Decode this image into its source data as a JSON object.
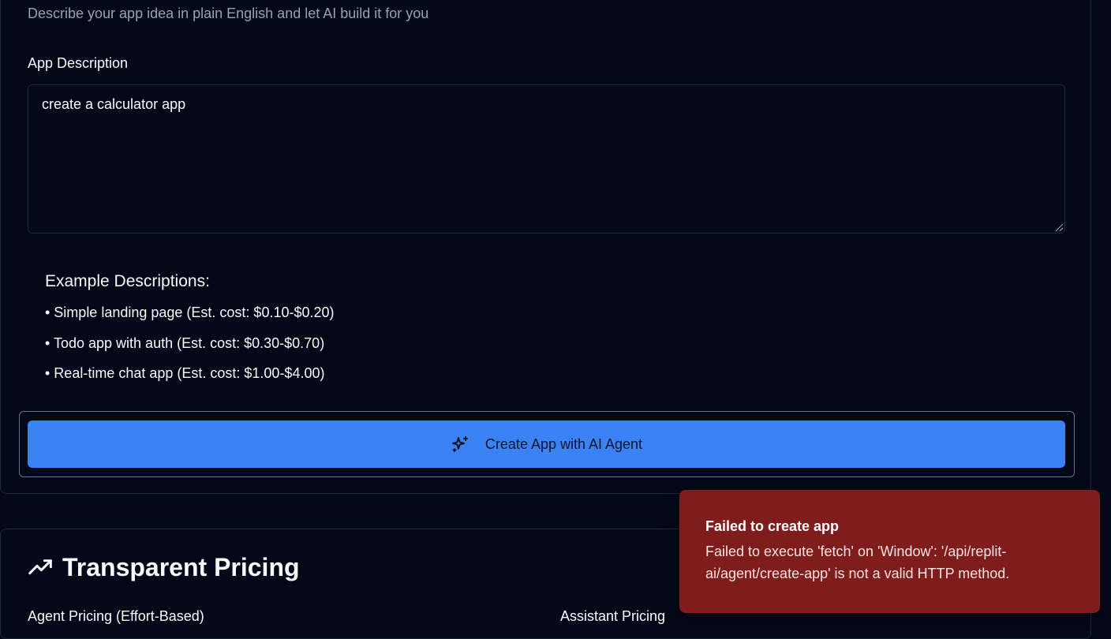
{
  "create_card": {
    "subtitle": "Describe your app idea in plain English and let AI build it for you",
    "field_label": "App Description",
    "textarea_value": "create a calculator app",
    "examples_title": "Example Descriptions:",
    "examples": [
      "• Simple landing page (Est. cost: $0.10-$0.20)",
      "• Todo app with auth (Est. cost: $0.30-$0.70)",
      "• Real-time chat app (Est. cost: $1.00-$4.00)"
    ],
    "button_label": "Create App with AI Agent",
    "button_icon": "sparkles-icon"
  },
  "pricing_card": {
    "title": "Transparent Pricing",
    "title_icon": "trending-up-icon",
    "left_subheading": "Agent Pricing (Effort-Based)",
    "right_subheading": "Assistant Pricing"
  },
  "toast": {
    "title": "Failed to create app",
    "message": "Failed to execute 'fetch' on 'Window': '/api/replit-ai/agent/create-app' is not a valid HTTP method."
  },
  "colors": {
    "background": "#020817",
    "border": "#1e293b",
    "primary": "#3b82f6",
    "toast": "#7f1d1d",
    "muted_text": "#94a3b8"
  }
}
